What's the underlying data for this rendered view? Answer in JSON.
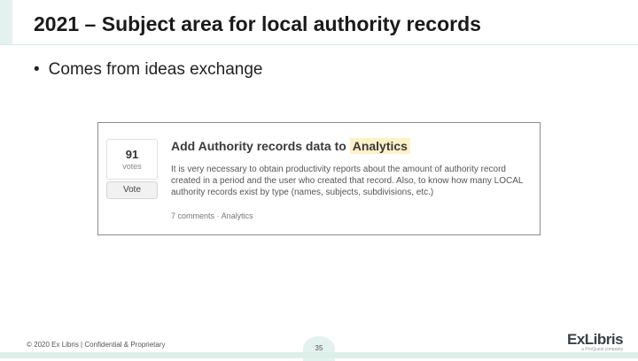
{
  "slide": {
    "title": "2021 – Subject area for local authority records",
    "bullet": "Comes from ideas exchange"
  },
  "idea_card": {
    "vote_count": "91",
    "vote_unit": "votes",
    "vote_button": "Vote",
    "title_prefix": "Add Authority records data to",
    "title_highlight": "Analytics",
    "description": "It is very necessary to obtain productivity reports about the amount of authority record created in a period and the user who created that record. Also, to know how many LOCAL authority records exist by type (names, subjects, subdivisions, etc.)",
    "comments": "7 comments",
    "separator": "·",
    "category": "Analytics"
  },
  "footer": {
    "copyright": "© 2020 Ex Libris | Confidential & Proprietary",
    "page_number": "35",
    "logo_text": "ExLibris",
    "logo_subtext": "a ProQuest company"
  },
  "colors": {
    "accent_mint": "#e3f2ef",
    "highlight": "#fff1c7",
    "title_text": "#1a1a1a"
  }
}
